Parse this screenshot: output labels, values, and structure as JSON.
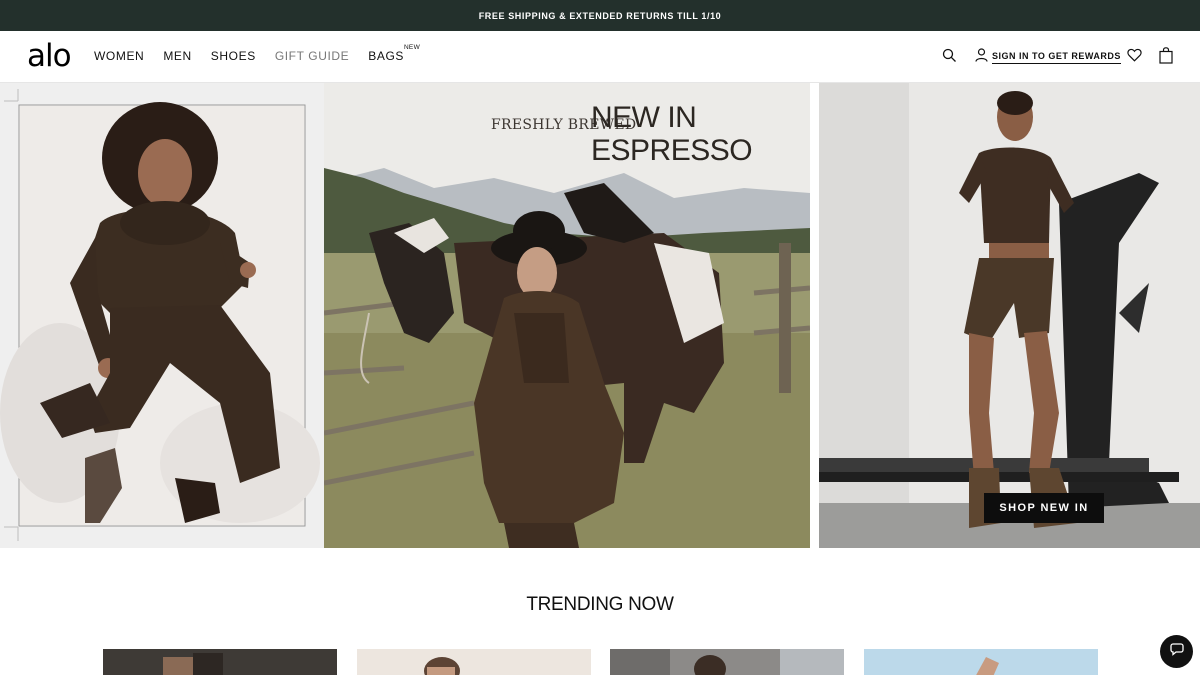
{
  "promo": {
    "text": "FREE SHIPPING & EXTENDED RETURNS TILL 1/10"
  },
  "header": {
    "logo": "alo",
    "nav": [
      {
        "label": "WOMEN"
      },
      {
        "label": "MEN"
      },
      {
        "label": "SHOES"
      },
      {
        "label": "GIFT GUIDE"
      },
      {
        "label": "BAGS",
        "badge": "NEW"
      }
    ],
    "rewards_label": "SIGN IN TO GET REWARDS",
    "icons": [
      "search-icon",
      "user-icon",
      "heart-icon",
      "bag-icon"
    ]
  },
  "hero": {
    "tagline": "FRESHLY BREWED",
    "headline_line1": "NEW IN",
    "headline_line2": "ESPRESSO",
    "cta_label": "SHOP NEW IN"
  },
  "trending": {
    "title": "TRENDING NOW"
  },
  "colors": {
    "promo_bg": "#23302c",
    "espresso": "#3f2e22",
    "cta_bg": "#0d0d0d"
  }
}
